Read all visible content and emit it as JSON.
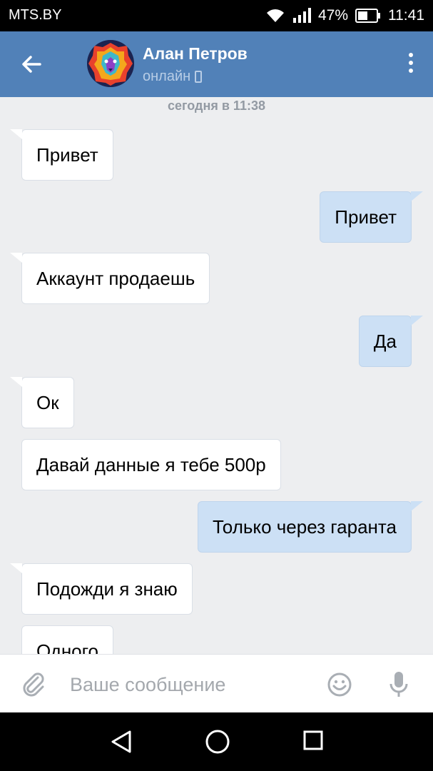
{
  "status_bar": {
    "carrier": "MTS.BY",
    "battery": "47%",
    "time": "11:41"
  },
  "header": {
    "contact_name": "Алан Петров",
    "contact_status": "онлайн"
  },
  "chat": {
    "date_label": "сегодня в 11:38",
    "messages": [
      {
        "dir": "in",
        "text": "Привет"
      },
      {
        "dir": "out",
        "text": "Привет"
      },
      {
        "dir": "in",
        "text": "Аккаунт продаешь"
      },
      {
        "dir": "out",
        "text": "Да"
      },
      {
        "dir": "in",
        "text": "Ок"
      },
      {
        "dir": "in",
        "text": "Давай данные я тебе 500р"
      },
      {
        "dir": "out",
        "text": "Только через гаранта"
      },
      {
        "dir": "in",
        "text": "Подожди я знаю"
      },
      {
        "dir": "in",
        "text": "Одного"
      }
    ]
  },
  "composer": {
    "placeholder": "Ваше сообщение",
    "value": ""
  },
  "colors": {
    "header": "#5181b8",
    "chat_bg": "#edeef0",
    "outgoing": "#cce0f5",
    "incoming": "#ffffff"
  }
}
